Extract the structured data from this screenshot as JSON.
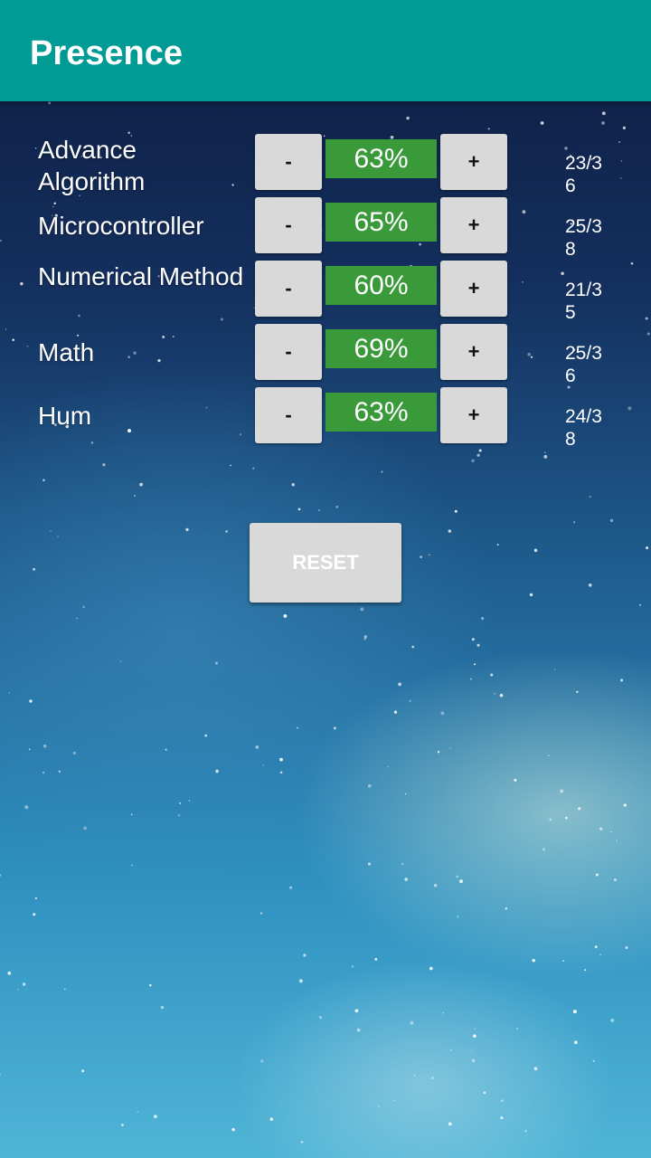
{
  "app": {
    "title": "Presence"
  },
  "subjects": [
    {
      "name": "Advance Algorithm",
      "minus_label": "-",
      "percent": "63%",
      "plus_label": "+",
      "ratio": "23/36"
    },
    {
      "name": "Microcontroller",
      "minus_label": "-",
      "percent": "65%",
      "plus_label": "+",
      "ratio": "25/38"
    },
    {
      "name": "Numerical Method",
      "minus_label": "-",
      "percent": "60%",
      "plus_label": "+",
      "ratio": "21/35"
    },
    {
      "name": "Math",
      "minus_label": "-",
      "percent": "69%",
      "plus_label": "+",
      "ratio": "25/36"
    },
    {
      "name": "Hum",
      "minus_label": "-",
      "percent": "63%",
      "plus_label": "+",
      "ratio": "24/38"
    }
  ],
  "reset_label": "RESET",
  "colors": {
    "appbar": "#009b95",
    "percent_bg": "#3a9a3a",
    "button_bg": "#d9d9d9"
  }
}
